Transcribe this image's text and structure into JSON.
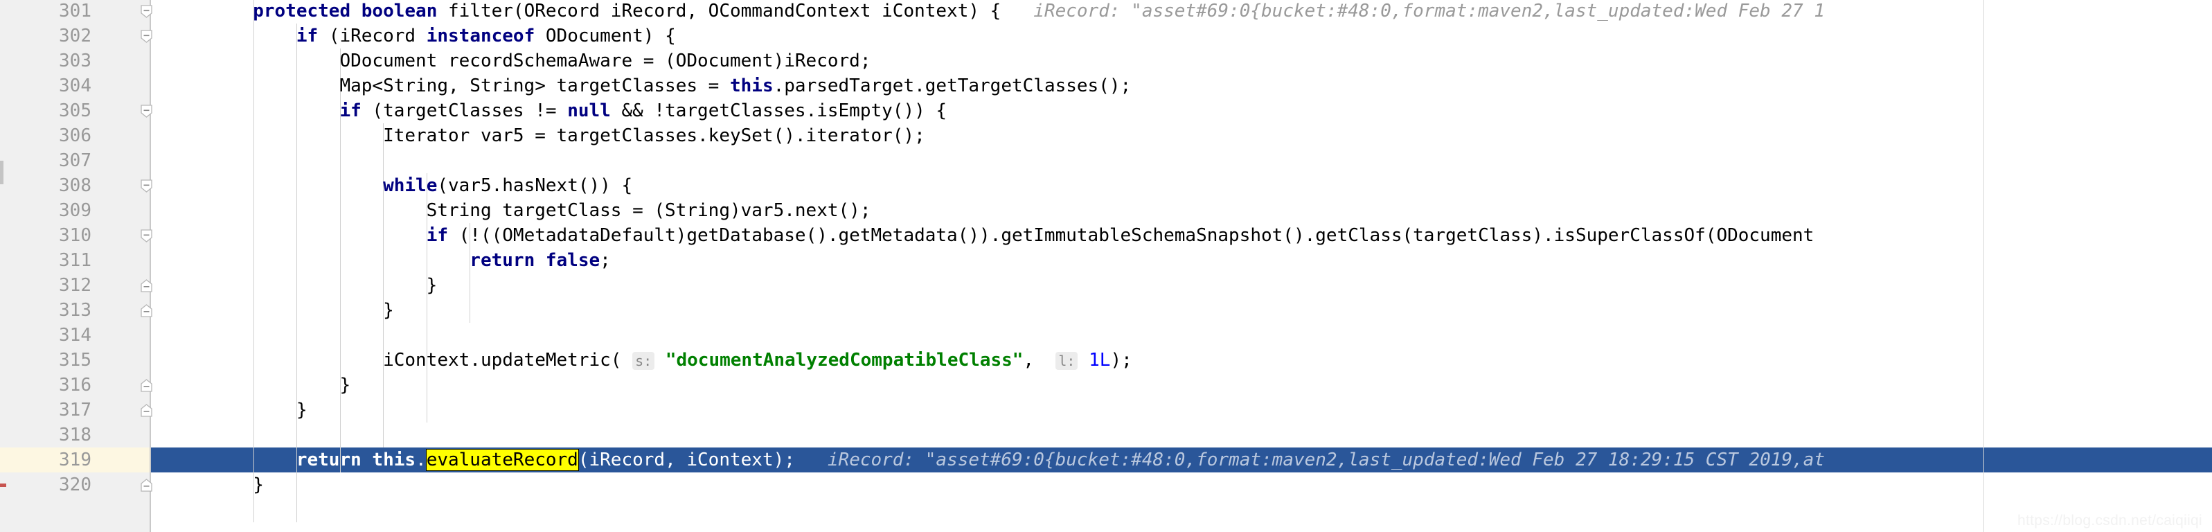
{
  "editor": {
    "watermark": "https://blog.csdn.net/caiqiiqi",
    "selected_line": 319,
    "highlighted_identifier": "evaluateRecord",
    "colors": {
      "gutter_bg": "#f0f0f0",
      "editor_bg": "#ffffff",
      "line_number": "#999999",
      "keyword": "#000080",
      "string": "#008000",
      "number": "#0000ff",
      "inline_hint": "#9a9a9a",
      "selection_bg": "#2a5699",
      "selection_fg": "#ffffff",
      "caret_row_gutter": "#fdf7e2",
      "search_highlight": "#ffff00",
      "vcs_mark": "#c75450"
    }
  },
  "lines": [
    {
      "number": "301",
      "fold": "open",
      "tokens": [
        {
          "t": "        ",
          "c": "plain"
        },
        {
          "t": "protected boolean ",
          "c": "kw"
        },
        {
          "t": "filter(ORecord iRecord, OCommandContext iContext) {",
          "c": "plain"
        },
        {
          "t": "   iRecord: \"asset#69:0{bucket:#48:0,format:maven2,last_updated:Wed Feb 27 1",
          "c": "hint"
        }
      ]
    },
    {
      "number": "302",
      "fold": "open",
      "tokens": [
        {
          "t": "            ",
          "c": "plain"
        },
        {
          "t": "if ",
          "c": "kw"
        },
        {
          "t": "(iRecord ",
          "c": "plain"
        },
        {
          "t": "instanceof ",
          "c": "kw"
        },
        {
          "t": "ODocument) {",
          "c": "plain"
        }
      ]
    },
    {
      "number": "303",
      "fold": "none",
      "tokens": [
        {
          "t": "                ODocument recordSchemaAware = (ODocument)iRecord;",
          "c": "plain"
        }
      ]
    },
    {
      "number": "304",
      "fold": "none",
      "tokens": [
        {
          "t": "                Map<String, String> targetClasses = ",
          "c": "plain"
        },
        {
          "t": "this",
          "c": "kw"
        },
        {
          "t": ".parsedTarget.getTargetClasses();",
          "c": "plain"
        }
      ]
    },
    {
      "number": "305",
      "fold": "open",
      "tokens": [
        {
          "t": "                ",
          "c": "plain"
        },
        {
          "t": "if ",
          "c": "kw"
        },
        {
          "t": "(targetClasses != ",
          "c": "plain"
        },
        {
          "t": "null",
          "c": "kw"
        },
        {
          "t": " && !targetClasses.isEmpty()) {",
          "c": "plain"
        }
      ]
    },
    {
      "number": "306",
      "fold": "none",
      "tokens": [
        {
          "t": "                    Iterator var5 = targetClasses.keySet().iterator();",
          "c": "plain"
        }
      ]
    },
    {
      "number": "307",
      "fold": "none",
      "tokens": [
        {
          "t": "",
          "c": "plain"
        }
      ]
    },
    {
      "number": "308",
      "fold": "open",
      "tokens": [
        {
          "t": "                    ",
          "c": "plain"
        },
        {
          "t": "while",
          "c": "kw"
        },
        {
          "t": "(var5.hasNext()) {",
          "c": "plain"
        }
      ]
    },
    {
      "number": "309",
      "fold": "none",
      "tokens": [
        {
          "t": "                        String targetClass = (String)var5.next();",
          "c": "plain"
        }
      ]
    },
    {
      "number": "310",
      "fold": "open",
      "tokens": [
        {
          "t": "                        ",
          "c": "plain"
        },
        {
          "t": "if ",
          "c": "kw"
        },
        {
          "t": "(!((OMetadataDefault)getDatabase().getMetadata()).getImmutableSchemaSnapshot().getClass(targetClass).isSuperClassOf(ODocument",
          "c": "plain"
        }
      ]
    },
    {
      "number": "311",
      "fold": "none",
      "tokens": [
        {
          "t": "                            ",
          "c": "plain"
        },
        {
          "t": "return false",
          "c": "kw"
        },
        {
          "t": ";",
          "c": "plain"
        }
      ]
    },
    {
      "number": "312",
      "fold": "close",
      "tokens": [
        {
          "t": "                        }",
          "c": "plain"
        }
      ]
    },
    {
      "number": "313",
      "fold": "close",
      "tokens": [
        {
          "t": "                    }",
          "c": "plain"
        }
      ]
    },
    {
      "number": "314",
      "fold": "none",
      "tokens": [
        {
          "t": "",
          "c": "plain"
        }
      ]
    },
    {
      "number": "315",
      "fold": "none",
      "tokens": [
        {
          "t": "                    iContext.updateMetric( ",
          "c": "plain"
        },
        {
          "t": "s:",
          "c": "param-hint"
        },
        {
          "t": " ",
          "c": "plain"
        },
        {
          "t": "\"documentAnalyzedCompatibleClass\"",
          "c": "str"
        },
        {
          "t": ",  ",
          "c": "plain"
        },
        {
          "t": "l:",
          "c": "param-hint"
        },
        {
          "t": " ",
          "c": "plain"
        },
        {
          "t": "1L",
          "c": "num"
        },
        {
          "t": ");",
          "c": "plain"
        }
      ]
    },
    {
      "number": "316",
      "fold": "close",
      "tokens": [
        {
          "t": "                }",
          "c": "plain"
        }
      ]
    },
    {
      "number": "317",
      "fold": "close",
      "tokens": [
        {
          "t": "            }",
          "c": "plain"
        }
      ]
    },
    {
      "number": "318",
      "fold": "none",
      "tokens": [
        {
          "t": "",
          "c": "plain"
        }
      ]
    },
    {
      "number": "319",
      "fold": "none",
      "selected": true,
      "tokens": [
        {
          "t": "            ",
          "c": "sel-txt"
        },
        {
          "t": "return this",
          "c": "sel-txt-bold"
        },
        {
          "t": ".",
          "c": "sel-txt"
        },
        {
          "t": "evaluateRecord",
          "c": "ident-hl"
        },
        {
          "t": "(iRecord, iContext);",
          "c": "sel-txt"
        },
        {
          "t": "   iRecord: \"asset#69:0{bucket:#48:0,format:maven2,last_updated:Wed Feb 27 18:29:15 CST 2019,at",
          "c": "hint-sel"
        }
      ]
    },
    {
      "number": "320",
      "fold": "close",
      "tokens": [
        {
          "t": "        }",
          "c": "plain"
        }
      ]
    }
  ]
}
